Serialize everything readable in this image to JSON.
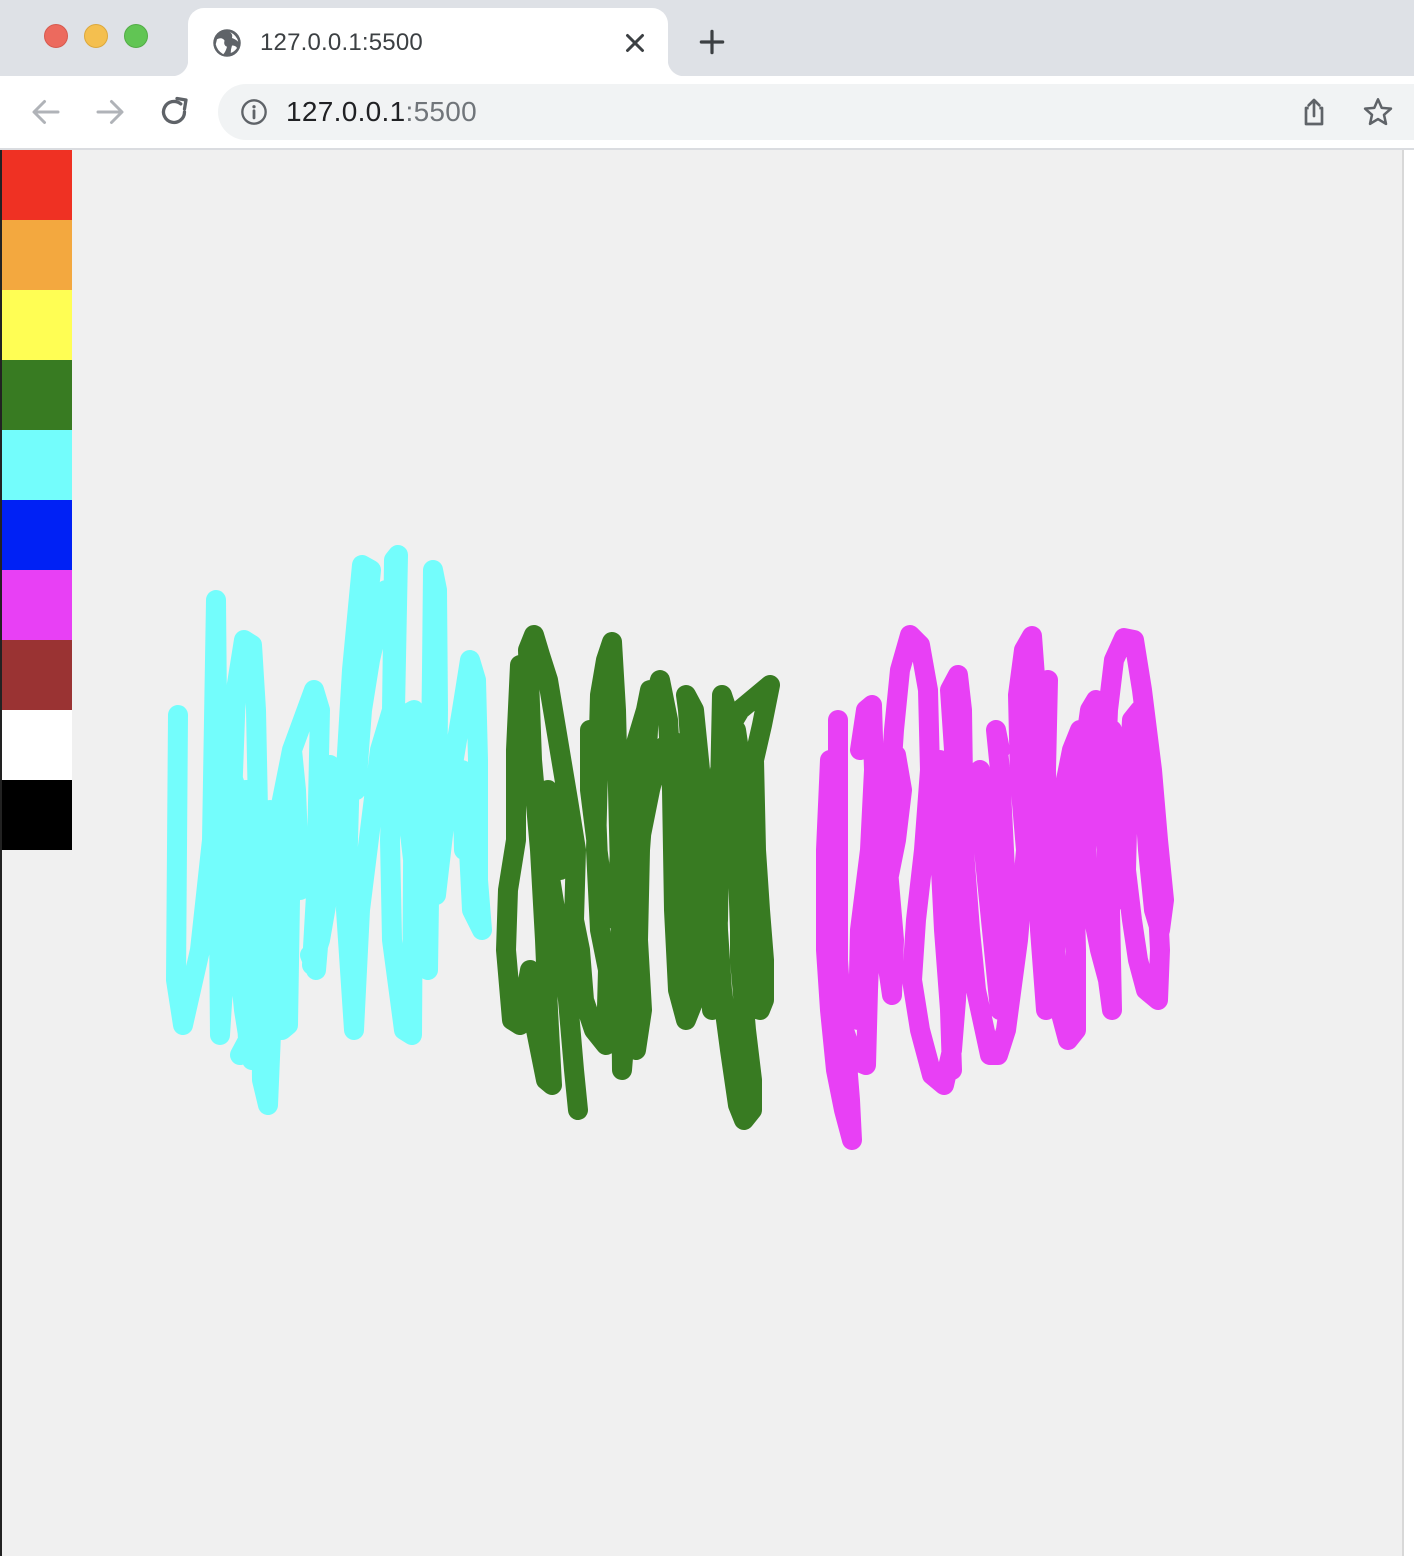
{
  "browser": {
    "tab": {
      "title": "127.0.0.1:5500",
      "favicon": "globe-icon"
    },
    "address_bar": {
      "host": "127.0.0.1",
      "port": ":5500"
    },
    "icons": {
      "back": "arrow-left-icon",
      "forward": "arrow-right-icon",
      "reload": "reload-icon",
      "info": "info-icon",
      "share": "share-icon",
      "bookmark": "star-icon",
      "close_tab": "close-icon",
      "new_tab": "plus-icon"
    }
  },
  "palette": {
    "colors": [
      {
        "name": "red",
        "hex": "#ef3123"
      },
      {
        "name": "orange",
        "hex": "#f3a83f"
      },
      {
        "name": "yellow",
        "hex": "#fffe54"
      },
      {
        "name": "green",
        "hex": "#387b22"
      },
      {
        "name": "cyan",
        "hex": "#73fdfc"
      },
      {
        "name": "blue",
        "hex": "#0021f5"
      },
      {
        "name": "magenta",
        "hex": "#e840f5"
      },
      {
        "name": "brown",
        "hex": "#9a3333"
      },
      {
        "name": "white",
        "hex": "#ffffff"
      },
      {
        "name": "black",
        "hex": "#000000"
      }
    ]
  },
  "canvas": {
    "background": "#f0f0f0",
    "strokes": [
      {
        "color": "cyan"
      },
      {
        "color": "green"
      },
      {
        "color": "magenta"
      }
    ]
  }
}
